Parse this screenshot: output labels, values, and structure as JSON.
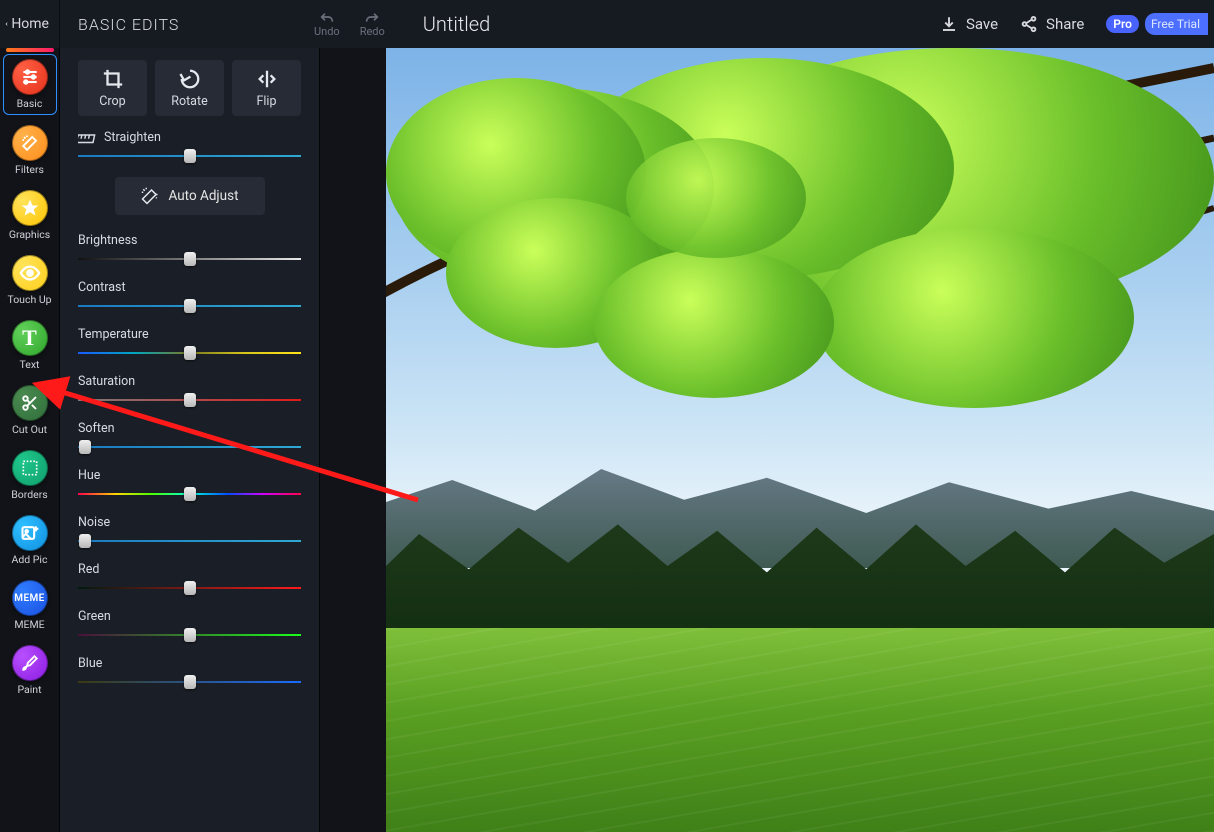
{
  "topbar": {
    "home_label": "Home",
    "panel_title": "BASIC EDITS",
    "undo_label": "Undo",
    "redo_label": "Redo",
    "image_title": "Untitled",
    "save_label": "Save",
    "share_label": "Share",
    "pro_badge": "Pro",
    "trial_label": "Free Trial"
  },
  "toolbar": [
    {
      "id": "basic",
      "label": "Basic",
      "color": "c-red",
      "active": true
    },
    {
      "id": "filters",
      "label": "Filters",
      "color": "c-orange"
    },
    {
      "id": "graphics",
      "label": "Graphics",
      "color": "c-yellow"
    },
    {
      "id": "touchup",
      "label": "Touch Up",
      "color": "c-yellow2"
    },
    {
      "id": "text",
      "label": "Text",
      "color": "c-green"
    },
    {
      "id": "cutout",
      "label": "Cut Out",
      "color": "c-dgreen"
    },
    {
      "id": "borders",
      "label": "Borders",
      "color": "c-teal"
    },
    {
      "id": "addpic",
      "label": "Add Pic",
      "color": "c-cyan"
    },
    {
      "id": "meme",
      "label": "MEME",
      "color": "c-blue"
    },
    {
      "id": "paint",
      "label": "Paint",
      "color": "c-purple"
    }
  ],
  "modes": {
    "crop": "Crop",
    "rotate": "Rotate",
    "flip": "Flip"
  },
  "controls": {
    "straighten": {
      "label": "Straighten",
      "pos": 50,
      "style": "g-blue",
      "icon": true
    },
    "auto_adjust": "Auto Adjust",
    "brightness": {
      "label": "Brightness",
      "pos": 50,
      "style": "g-bw"
    },
    "contrast": {
      "label": "Contrast",
      "pos": 50,
      "style": "g-blue"
    },
    "temperature": {
      "label": "Temperature",
      "pos": 50,
      "style": "g-temp"
    },
    "saturation": {
      "label": "Saturation",
      "pos": 50,
      "style": "g-sat"
    },
    "soften": {
      "label": "Soften",
      "pos": 3,
      "style": "g-blue"
    },
    "hue": {
      "label": "Hue",
      "pos": 50,
      "style": "g-hue"
    },
    "noise": {
      "label": "Noise",
      "pos": 3,
      "style": "g-blue"
    },
    "red": {
      "label": "Red",
      "pos": 50,
      "style": "g-red"
    },
    "green": {
      "label": "Green",
      "pos": 50,
      "style": "g-green"
    },
    "blue": {
      "label": "Blue",
      "pos": 50,
      "style": "g-blue2"
    }
  }
}
